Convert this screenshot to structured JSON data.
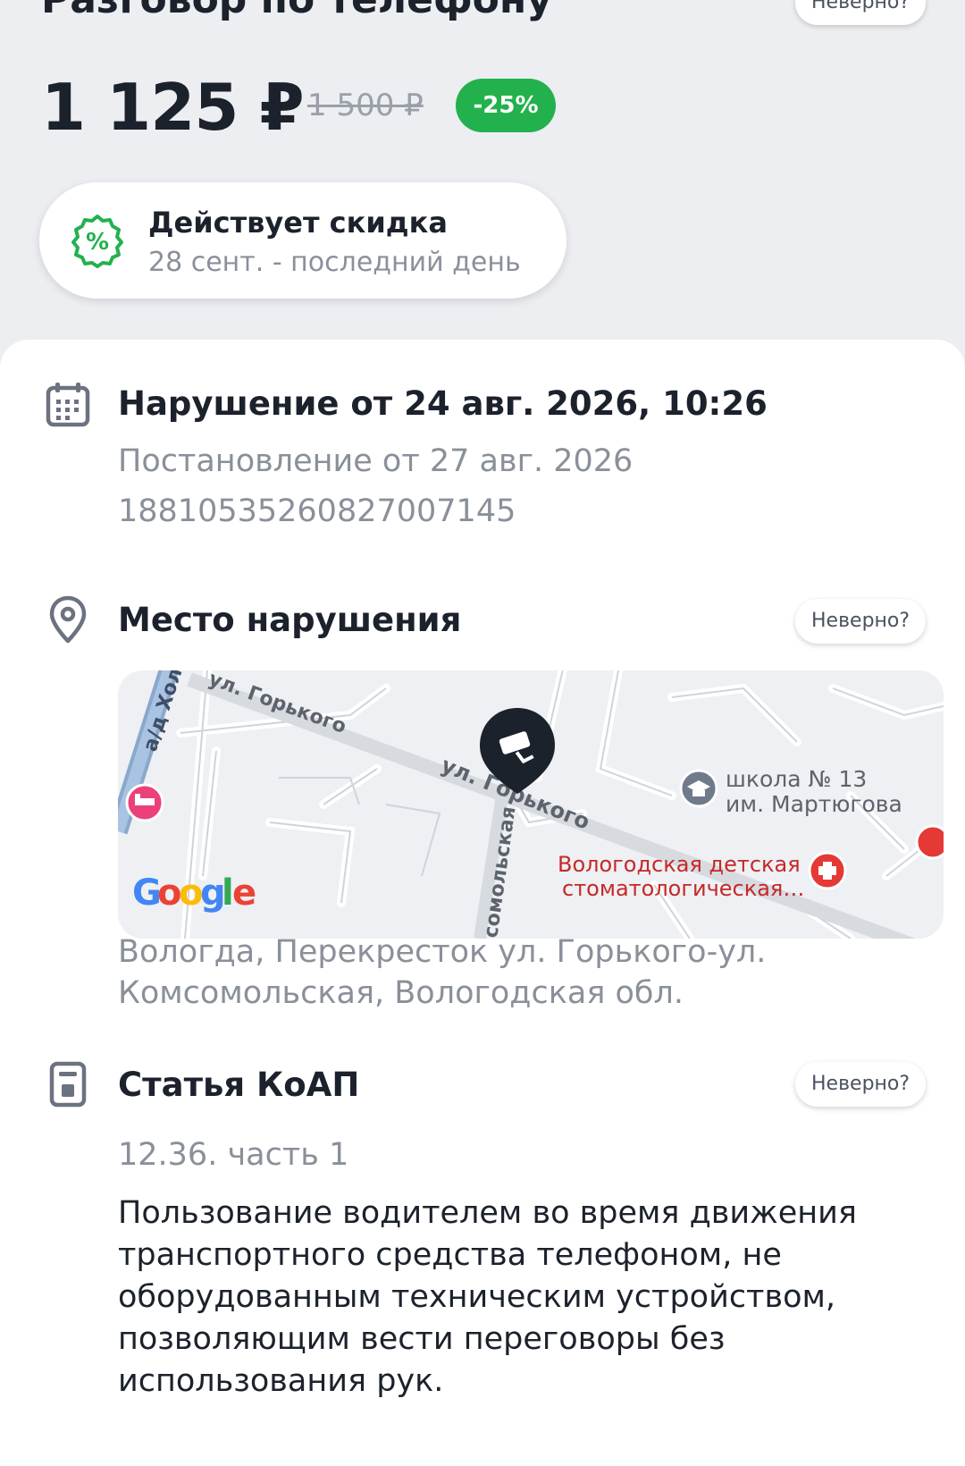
{
  "header": {
    "title": "Разговор по телефону",
    "incorrect_label": "Неверно?"
  },
  "price": {
    "current": "1 125 ₽",
    "old": "1 500 ₽",
    "discount": "-25%"
  },
  "promo": {
    "title": "Действует скидка",
    "subtitle": "28 сент. - последний день",
    "icon": "percent-badge-icon"
  },
  "violation": {
    "title": "Нарушение от 24 авг. 2026, 10:26",
    "decree": "Постановление от 27 авг. 2026",
    "number": "18810535260827007145",
    "icon": "calendar-icon"
  },
  "location": {
    "title": "Место нарушения",
    "incorrect_label": "Неверно?",
    "address": "Вологда, Перекресток ул. Горького-ул. Комсомольская, Вологодская обл.",
    "icon": "location-pin-icon",
    "map": {
      "street_1": "ул. Горького",
      "street_1_top": "ул. Горького",
      "street_2": "ул. Комсомольская",
      "street_2_visible": "сомольская",
      "road": "а/д Хол",
      "poi_school_line1": "школа № 13",
      "poi_school_line2": "им. Мартюгова",
      "poi_clinic_line1": "Вологодская детская",
      "poi_clinic_line2": "стоматологическая…",
      "provider": "Google",
      "marker_icon": "traffic-camera-icon"
    }
  },
  "article": {
    "title": "Статья КоАП",
    "incorrect_label": "Неверно?",
    "code": "12.36. часть 1",
    "description": "Пользование водителем во время движения транспортного средства телефоном, не оборудованным техническим устройством, позволяющим вести переговоры без использования рук.",
    "icon": "document-icon"
  },
  "colors": {
    "accent_green": "#23b14d",
    "text_dark": "#1c222c",
    "text_muted": "#8a909a",
    "icon_slate": "#6b7280",
    "map_clinic_red": "#c62828"
  }
}
